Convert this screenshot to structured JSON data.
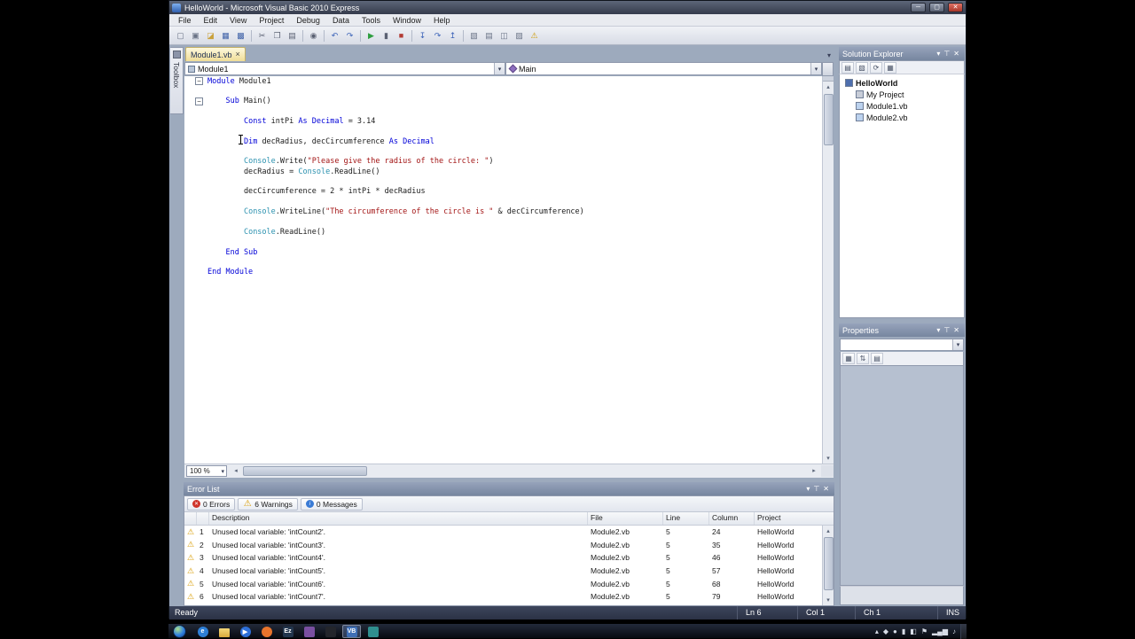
{
  "window": {
    "title": "HelloWorld - Microsoft Visual Basic 2010 Express",
    "menu": [
      "File",
      "Edit",
      "View",
      "Project",
      "Debug",
      "Data",
      "Tools",
      "Window",
      "Help"
    ]
  },
  "glyphs": {
    "minimize": "─",
    "maximize": "▢",
    "close": "✕",
    "close_small": "×",
    "dropdown": "▾",
    "up": "▴",
    "down": "▾",
    "left": "◂",
    "right": "▸",
    "pin": "⊤",
    "warning": "⚠",
    "fold": "−"
  },
  "panel_icons": [
    {
      "name": "window-position-icon",
      "g": "▾"
    },
    {
      "name": "auto-hide-pin-icon",
      "g": "⊤"
    },
    {
      "name": "close-icon",
      "g": "✕"
    }
  ],
  "toolbox_label": "Toolbox",
  "toolbar_icons": [
    {
      "name": "new-project-icon",
      "g": "▢",
      "c": "#6a7386"
    },
    {
      "name": "add-item-icon",
      "g": "▣",
      "c": "#6a7386"
    },
    {
      "name": "open-file-icon",
      "g": "◪",
      "c": "#c9a13b"
    },
    {
      "name": "save-icon",
      "g": "▦",
      "c": "#3f62a8"
    },
    {
      "name": "save-all-icon",
      "g": "▩",
      "c": "#3f62a8"
    },
    {
      "sep": true
    },
    {
      "name": "cut-icon",
      "g": "✂",
      "c": "#5a6172"
    },
    {
      "name": "copy-icon",
      "g": "❐",
      "c": "#5a6172"
    },
    {
      "name": "paste-icon",
      "g": "▤",
      "c": "#5a6172"
    },
    {
      "sep": true
    },
    {
      "name": "find-icon",
      "g": "◉",
      "c": "#5a6172"
    },
    {
      "sep": true
    },
    {
      "name": "undo-icon",
      "g": "↶",
      "c": "#3a62b8"
    },
    {
      "name": "redo-icon",
      "g": "↷",
      "c": "#3a62b8"
    },
    {
      "sep": true
    },
    {
      "name": "start-debugging-icon",
      "g": "▶",
      "c": "#2e9e3f"
    },
    {
      "name": "break-all-icon",
      "g": "▮",
      "c": "#5a6172"
    },
    {
      "name": "stop-debugging-icon",
      "g": "■",
      "c": "#b23b34"
    },
    {
      "sep": true
    },
    {
      "name": "step-into-icon",
      "g": "↧",
      "c": "#3a62b8"
    },
    {
      "name": "step-over-icon",
      "g": "↷",
      "c": "#3a62b8"
    },
    {
      "name": "step-out-icon",
      "g": "↥",
      "c": "#3a62b8"
    },
    {
      "sep": true
    },
    {
      "name": "solution-explorer-icon",
      "g": "▧",
      "c": "#6a7386"
    },
    {
      "name": "properties-window-icon",
      "g": "▤",
      "c": "#6a7386"
    },
    {
      "name": "object-browser-icon",
      "g": "◫",
      "c": "#6a7386"
    },
    {
      "name": "toolbox-window-icon",
      "g": "▨",
      "c": "#6a7386"
    },
    {
      "name": "error-list-window-icon",
      "g": "⚠",
      "c": "#cf9a00"
    }
  ],
  "editor": {
    "tab": "Module1.vb",
    "left_dropdown": "Module1",
    "right_dropdown": "Main",
    "zoom": "100 %",
    "colors": {
      "keyword": "#0000d8",
      "plain": "#1a1a1a",
      "string": "#a31515",
      "class": "#2b91af"
    },
    "lines": [
      {
        "fold": true,
        "tokens": [
          {
            "t": "Module ",
            "c": "k"
          },
          {
            "t": "Module1",
            "c": "p"
          }
        ]
      },
      {
        "tokens": []
      },
      {
        "fold": true,
        "tokens": [
          {
            "t": "    ",
            "c": "p"
          },
          {
            "t": "Sub ",
            "c": "k"
          },
          {
            "t": "Main()",
            "c": "p"
          }
        ]
      },
      {
        "tokens": []
      },
      {
        "tokens": [
          {
            "t": "        ",
            "c": "p"
          },
          {
            "t": "Const ",
            "c": "k"
          },
          {
            "t": "intPi ",
            "c": "p"
          },
          {
            "t": "As Decimal",
            "c": "k"
          },
          {
            "t": " = 3.14",
            "c": "p"
          }
        ]
      },
      {
        "tokens": []
      },
      {
        "tokens": [
          {
            "t": "        ",
            "c": "p"
          },
          {
            "t": "Dim ",
            "c": "k"
          },
          {
            "t": "decRadius, decCircumference ",
            "c": "p"
          },
          {
            "t": "As Decimal",
            "c": "k"
          }
        ]
      },
      {
        "tokens": []
      },
      {
        "tokens": [
          {
            "t": "        ",
            "c": "p"
          },
          {
            "t": "Console",
            "c": "c"
          },
          {
            "t": ".Write(",
            "c": "p"
          },
          {
            "t": "\"Please give the radius of the circle: \"",
            "c": "s"
          },
          {
            "t": ")",
            "c": "p"
          }
        ]
      },
      {
        "tokens": [
          {
            "t": "        decRadius = ",
            "c": "p"
          },
          {
            "t": "Console",
            "c": "c"
          },
          {
            "t": ".ReadLine()",
            "c": "p"
          }
        ]
      },
      {
        "tokens": []
      },
      {
        "tokens": [
          {
            "t": "        decCircumference = 2 * intPi * decRadius",
            "c": "p"
          }
        ]
      },
      {
        "tokens": []
      },
      {
        "tokens": [
          {
            "t": "        ",
            "c": "p"
          },
          {
            "t": "Console",
            "c": "c"
          },
          {
            "t": ".WriteLine(",
            "c": "p"
          },
          {
            "t": "\"The circumference of the circle is \"",
            "c": "s"
          },
          {
            "t": " & decCircumference)",
            "c": "p"
          }
        ]
      },
      {
        "tokens": []
      },
      {
        "tokens": [
          {
            "t": "        ",
            "c": "p"
          },
          {
            "t": "Console",
            "c": "c"
          },
          {
            "t": ".ReadLine()",
            "c": "p"
          }
        ]
      },
      {
        "tokens": []
      },
      {
        "tokens": [
          {
            "t": "    ",
            "c": "p"
          },
          {
            "t": "End Sub",
            "c": "k"
          }
        ]
      },
      {
        "tokens": []
      },
      {
        "tokens": [
          {
            "t": "End Module",
            "c": "k"
          }
        ]
      }
    ]
  },
  "solution_explorer": {
    "title": "Solution Explorer",
    "toolbar": [
      {
        "name": "se-properties-icon",
        "g": "▤"
      },
      {
        "name": "show-all-files-icon",
        "g": "▧"
      },
      {
        "name": "refresh-icon",
        "g": "⟳"
      },
      {
        "name": "view-code-icon",
        "g": "▦"
      }
    ],
    "items": [
      {
        "label": "HelloWorld",
        "level": 0,
        "bold": true,
        "icon": "project"
      },
      {
        "label": "My Project",
        "level": 1,
        "bold": false,
        "icon": "myproject"
      },
      {
        "label": "Module1.vb",
        "level": 1,
        "bold": false,
        "icon": "vbfile"
      },
      {
        "label": "Module2.vb",
        "level": 1,
        "bold": false,
        "icon": "vbfile"
      }
    ]
  },
  "properties": {
    "title": "Properties",
    "toolbar": [
      {
        "name": "categorized-icon",
        "g": "▦"
      },
      {
        "name": "alphabetical-icon",
        "g": "⇅"
      },
      {
        "name": "property-pages-icon",
        "g": "▤"
      }
    ]
  },
  "error_list": {
    "title": "Error List",
    "filters": [
      {
        "name": "errors-filter-button",
        "icon": "error",
        "label": "0 Errors"
      },
      {
        "name": "warnings-filter-button",
        "icon": "warning",
        "label": "6 Warnings"
      },
      {
        "name": "messages-filter-button",
        "icon": "message",
        "label": "0 Messages"
      }
    ],
    "columns": [
      "Description",
      "File",
      "Line",
      "Column",
      "Project"
    ],
    "rows": [
      {
        "n": "1",
        "description": "Unused local variable: 'intCount2'.",
        "file": "Module2.vb",
        "line": "5",
        "column": "24",
        "project": "HelloWorld"
      },
      {
        "n": "2",
        "description": "Unused local variable: 'intCount3'.",
        "file": "Module2.vb",
        "line": "5",
        "column": "35",
        "project": "HelloWorld"
      },
      {
        "n": "3",
        "description": "Unused local variable: 'intCount4'.",
        "file": "Module2.vb",
        "line": "5",
        "column": "46",
        "project": "HelloWorld"
      },
      {
        "n": "4",
        "description": "Unused local variable: 'intCount5'.",
        "file": "Module2.vb",
        "line": "5",
        "column": "57",
        "project": "HelloWorld"
      },
      {
        "n": "5",
        "description": "Unused local variable: 'intCount6'.",
        "file": "Module2.vb",
        "line": "5",
        "column": "68",
        "project": "HelloWorld"
      },
      {
        "n": "6",
        "description": "Unused local variable: 'intCount7'.",
        "file": "Module2.vb",
        "line": "5",
        "column": "79",
        "project": "HelloWorld"
      }
    ]
  },
  "status_bar": {
    "ready": "Ready",
    "ln": "Ln 6",
    "col": "Col 1",
    "ch": "Ch 1",
    "ins": "INS"
  },
  "taskbar": {
    "apps": [
      {
        "name": "internet-explorer-icon",
        "glyph": "e",
        "bg": "#2e7fd6",
        "shape": "circle",
        "active": false
      },
      {
        "name": "windows-explorer-icon",
        "glyph": "",
        "bg": "#e3b83d",
        "shape": "folder",
        "active": false
      },
      {
        "name": "media-player-icon",
        "glyph": "▶",
        "bg": "#2d6fd8",
        "shape": "circle",
        "active": false
      },
      {
        "name": "firefox-icon",
        "glyph": "",
        "bg": "#e8742c",
        "shape": "circle",
        "active": false
      },
      {
        "name": "ezvid-icon",
        "glyph": "Ez",
        "bg": "#23364d",
        "shape": "square",
        "active": false
      },
      {
        "name": "app-icon-purple",
        "glyph": "",
        "bg": "#7a4fa0",
        "shape": "square",
        "active": false
      },
      {
        "name": "app-icon-dark",
        "glyph": "",
        "bg": "#23252b",
        "shape": "square",
        "active": false
      },
      {
        "name": "visual-basic-icon",
        "glyph": "VB",
        "bg": "#3f6fb5",
        "shape": "square",
        "active": true
      },
      {
        "name": "app-icon-teal",
        "glyph": "",
        "bg": "#2f8f8f",
        "shape": "square",
        "active": false
      }
    ],
    "tray": [
      {
        "name": "tray-expand-icon",
        "g": "▴"
      },
      {
        "name": "tray-icon-1",
        "g": "◆"
      },
      {
        "name": "tray-icon-2",
        "g": "●"
      },
      {
        "name": "tray-icon-3",
        "g": "▮"
      },
      {
        "name": "tray-icon-4",
        "g": "◧"
      },
      {
        "name": "action-center-icon",
        "g": "⚑"
      },
      {
        "name": "network-icon",
        "g": "▂▄▆"
      },
      {
        "name": "volume-icon",
        "g": "♪"
      }
    ]
  }
}
